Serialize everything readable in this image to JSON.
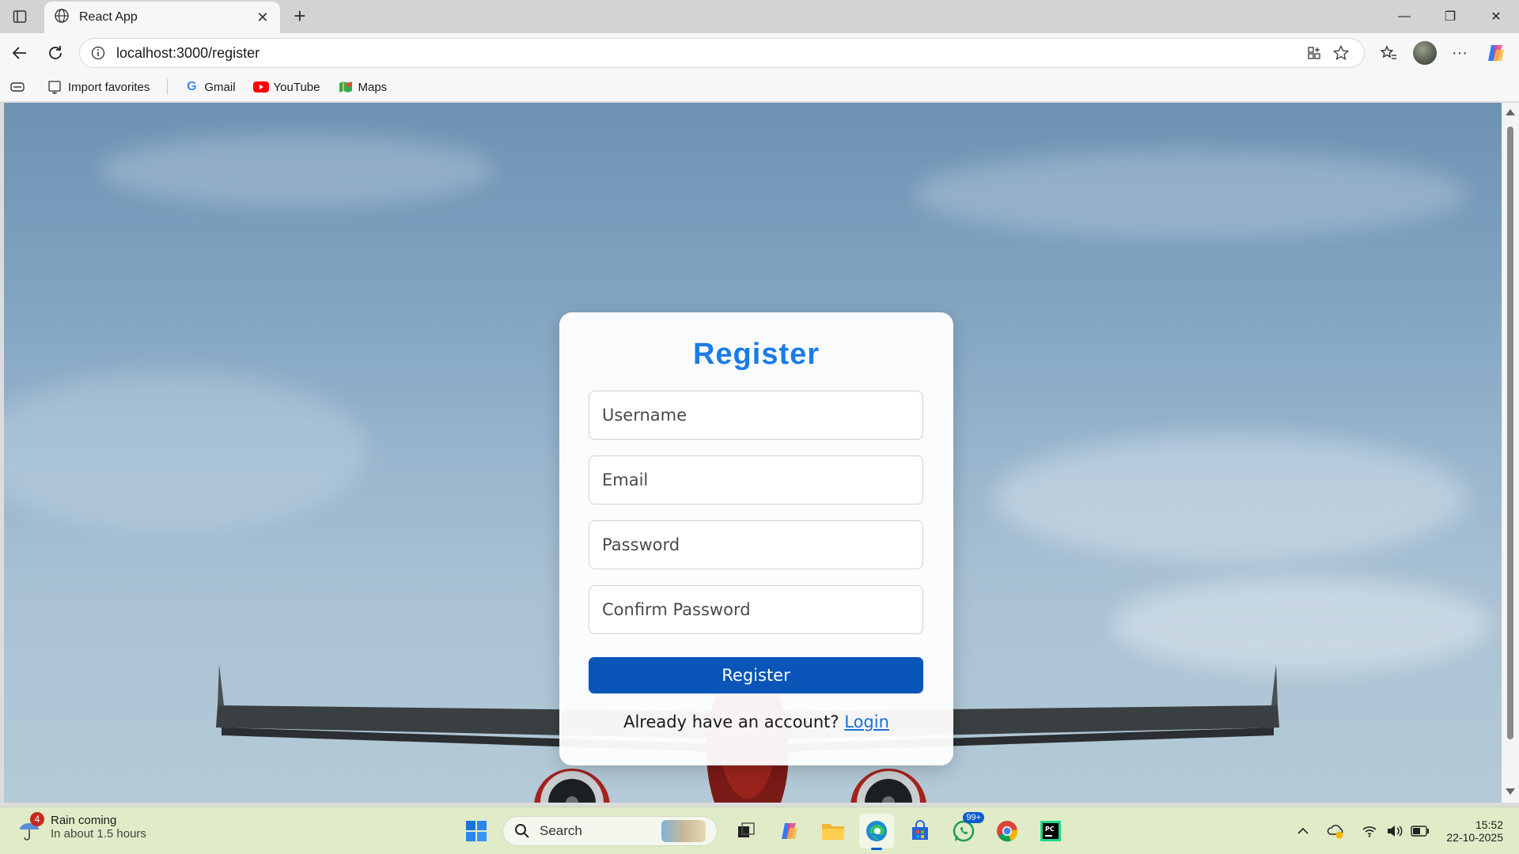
{
  "browser": {
    "tab_title": "React App",
    "url": "localhost:3000/register",
    "favorites": [
      {
        "label": "Import favorites",
        "icon": "import-icon"
      },
      {
        "label": "Gmail",
        "icon": "google-icon"
      },
      {
        "label": "YouTube",
        "icon": "youtube-icon"
      },
      {
        "label": "Maps",
        "icon": "maps-icon"
      }
    ]
  },
  "form": {
    "title": "Register",
    "username_placeholder": "Username",
    "email_placeholder": "Email",
    "password_placeholder": "Password",
    "confirm_placeholder": "Confirm Password",
    "submit_label": "Register",
    "login_prompt": "Already have an account?",
    "login_link": "Login"
  },
  "taskbar": {
    "weather_title": "Rain coming",
    "weather_subtitle": "In about 1.5 hours",
    "weather_badge": "4",
    "search_label": "Search",
    "whatsapp_badge": "99+",
    "time": "15:52",
    "date": "22-10-2025"
  },
  "colors": {
    "title_blue": "#1a7ce6",
    "button_blue": "#0a55b8",
    "link_blue": "#1a6ed8"
  }
}
